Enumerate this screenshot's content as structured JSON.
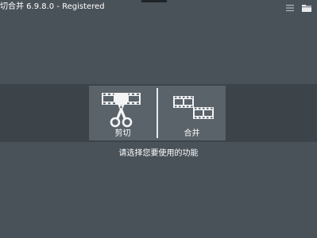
{
  "window": {
    "title": "切合并 6.9.8.0 - Registered"
  },
  "toolbar": {
    "menu_icon": "hamburger-menu-icon",
    "folder_icon": "folder-icon"
  },
  "functions": {
    "cut": {
      "label": "剪切",
      "icon": "scissors-film-icon"
    },
    "merge": {
      "label": "合并",
      "icon": "film-strips-merge-icon"
    }
  },
  "prompt": "请选择您要使用的功能",
  "colors": {
    "background": "#4a5259",
    "band": "#3c4349",
    "tile": "#5a626a",
    "foreground": "#ffffff"
  }
}
